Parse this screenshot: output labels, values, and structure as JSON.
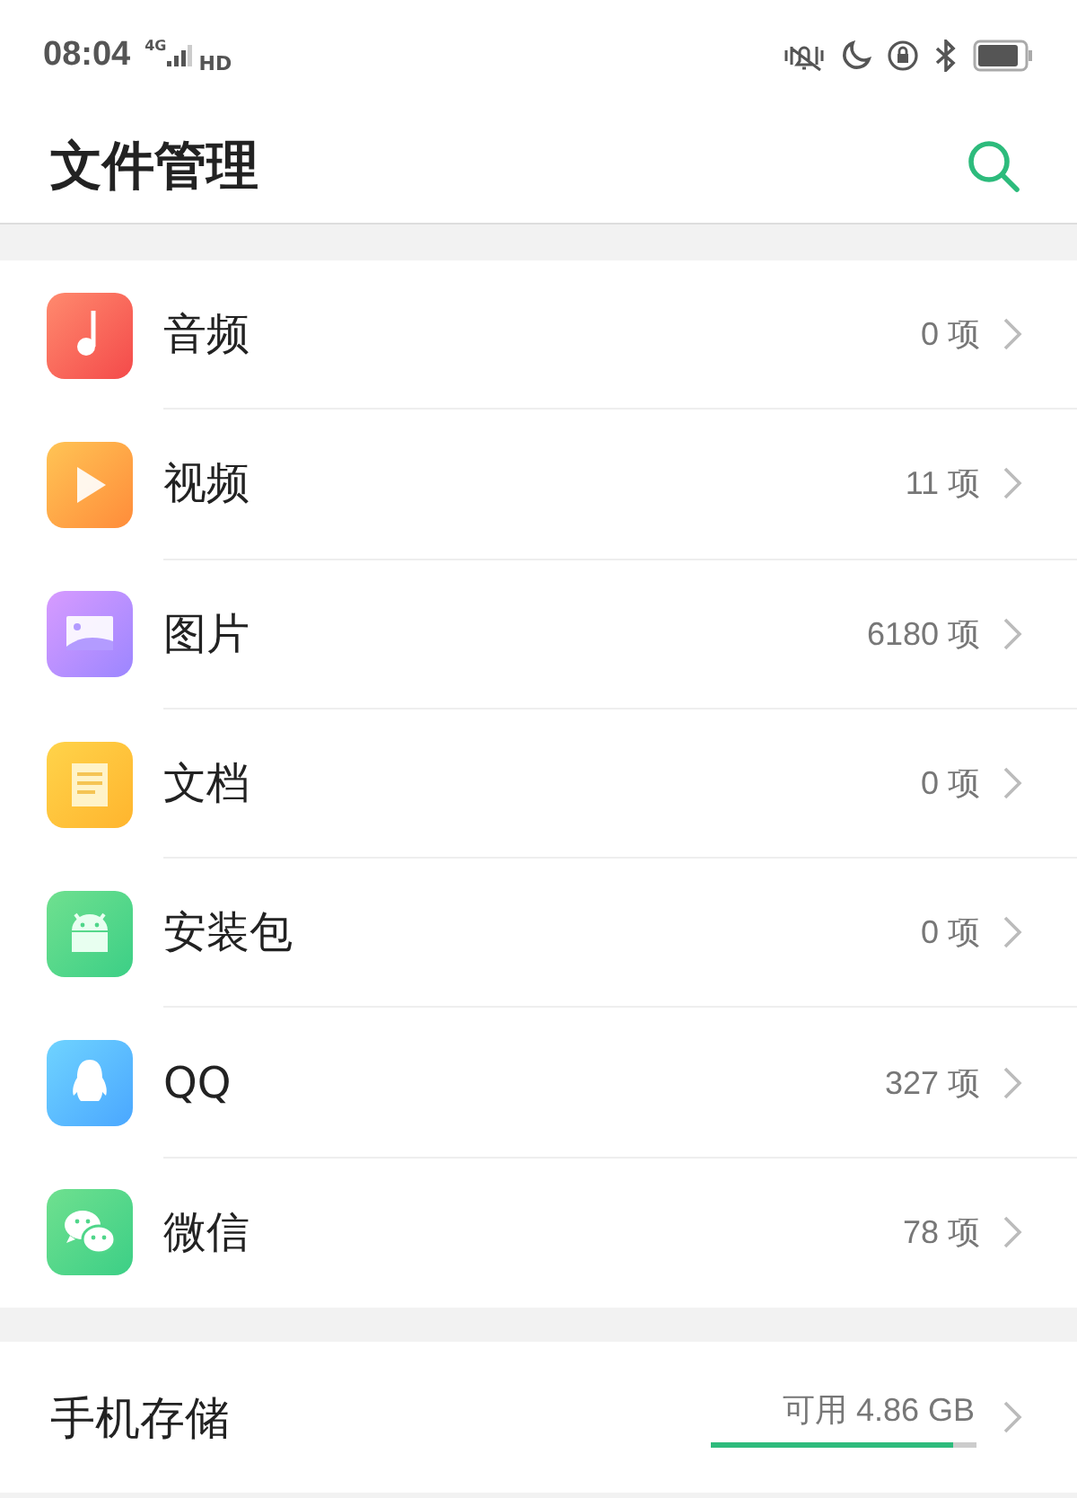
{
  "status_bar": {
    "time": "08:04",
    "network": "4G",
    "hd": "HD"
  },
  "header": {
    "title": "文件管理"
  },
  "categories": [
    {
      "kind": "audio",
      "label": "音频",
      "count": "0 项"
    },
    {
      "kind": "video",
      "label": "视频",
      "count": "11 项"
    },
    {
      "kind": "image",
      "label": "图片",
      "count": "6180 项"
    },
    {
      "kind": "document",
      "label": "文档",
      "count": "0 项"
    },
    {
      "kind": "package",
      "label": "安装包",
      "count": "0 项"
    },
    {
      "kind": "qq",
      "label": "QQ",
      "count": "327 项"
    },
    {
      "kind": "wechat",
      "label": "微信",
      "count": "78 项"
    }
  ],
  "storage": {
    "label": "手机存储",
    "available": "可用 4.86 GB",
    "level": 0.91
  }
}
